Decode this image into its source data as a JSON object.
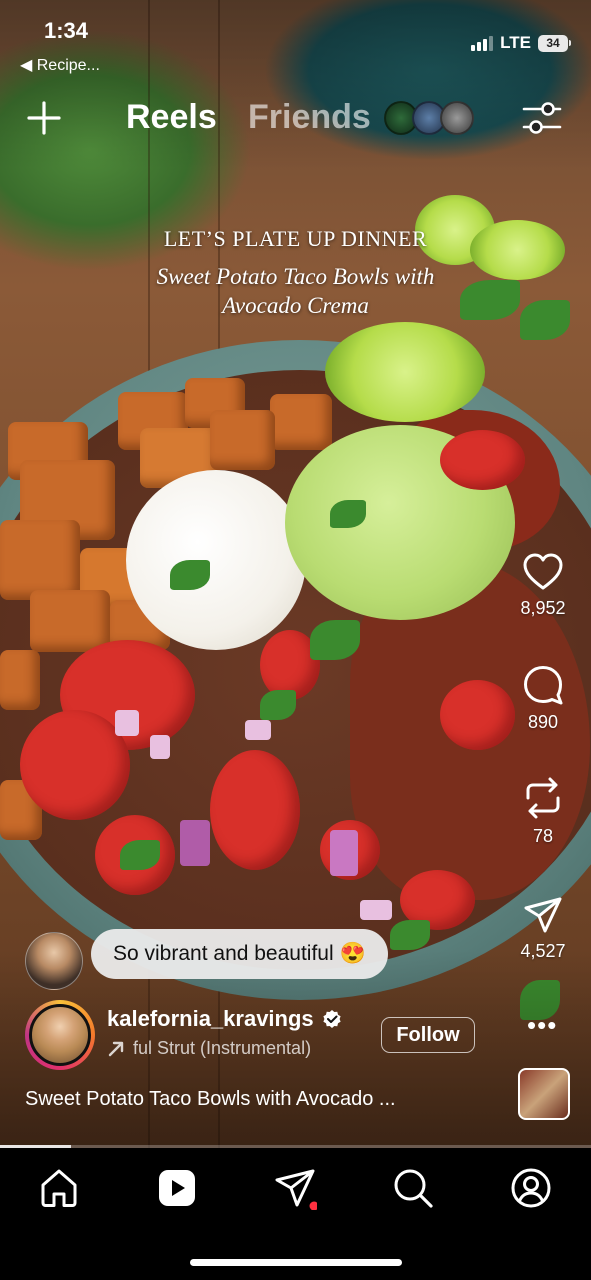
{
  "status_bar": {
    "time": "1:34",
    "back_app": "◀ Recipe...",
    "network": "LTE",
    "battery": "34"
  },
  "top_nav": {
    "tab_reels": "Reels",
    "tab_friends": "Friends"
  },
  "overlay": {
    "title": "LET’S PLATE UP DINNER",
    "subtitle_line1": "Sweet Potato Taco Bowls with",
    "subtitle_line2": "Avocado Crema"
  },
  "actions": {
    "likes": "8,952",
    "comments": "890",
    "reposts": "78",
    "shares": "4,527"
  },
  "comment": {
    "text": "So vibrant and beautiful 😍"
  },
  "account": {
    "username": "kalefornia_kravings",
    "audio": "ful Strut (Instrumental)",
    "follow_label": "Follow",
    "more": "•••"
  },
  "caption": "Sweet Potato Taco Bowls with Avocado ...",
  "playback": {
    "progress": 0.12
  },
  "colors": {
    "accent_notification": "#ff3040",
    "story_ring_start": "#f9c13a",
    "story_ring_end": "#c13584"
  }
}
